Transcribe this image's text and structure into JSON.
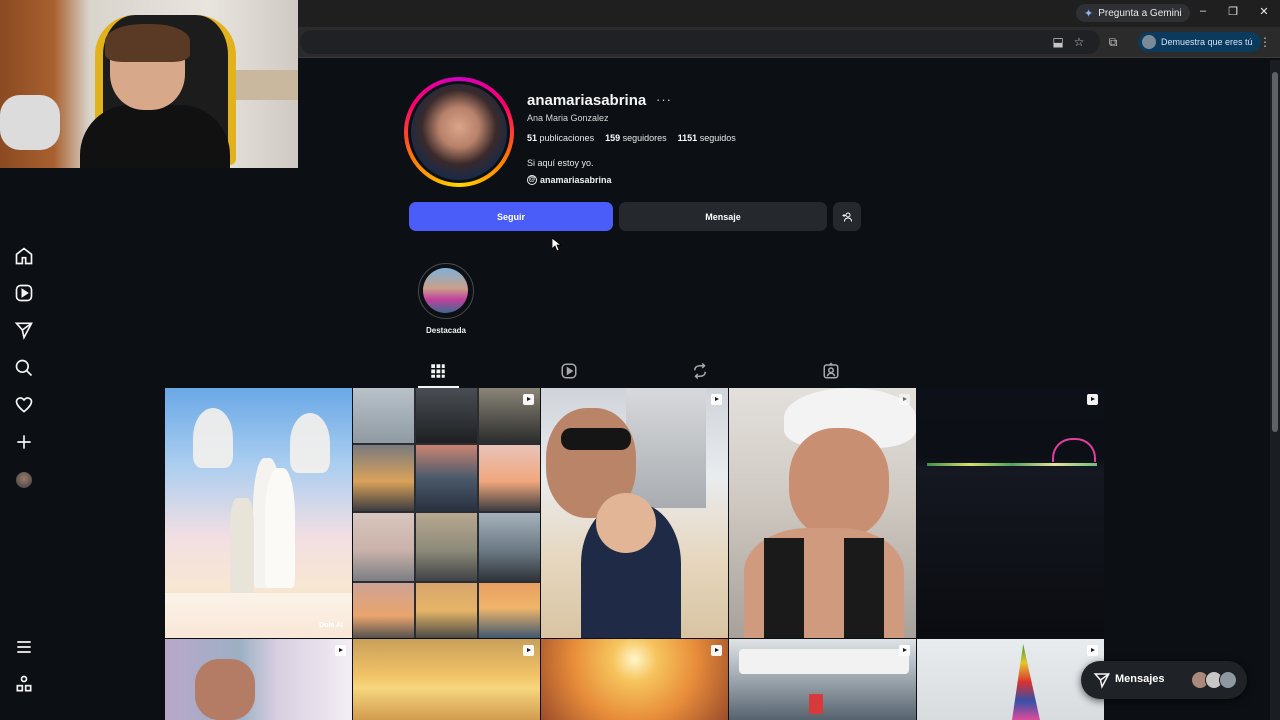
{
  "browser": {
    "gemini_label": "Pregunta a Gemini",
    "profile_chip": "Demuestra que eres tú",
    "window_controls": [
      "–",
      "❐",
      "✕"
    ]
  },
  "profile": {
    "username": "anamariasabrina",
    "more": "···",
    "full_name": "Ana Maria Gonzalez",
    "stats": [
      {
        "count": "51",
        "label": "publicaciones"
      },
      {
        "count": "159",
        "label": "seguidores"
      },
      {
        "count": "1151",
        "label": "seguidos"
      }
    ],
    "bio": "Si aquí estoy yo.",
    "threads_handle": "anamariasabrina",
    "follow_label": "Seguir",
    "message_label": "Mensaje",
    "add_user_glyph": "+👤"
  },
  "highlight": {
    "label": "Destacada"
  },
  "tabs": [
    "posts-grid",
    "reels",
    "reposts",
    "tagged"
  ],
  "grid": {
    "watermark": "Dola AI",
    "tiles": [
      {
        "name": "angels-family-post",
        "reel": false
      },
      {
        "name": "sunset-collage-post",
        "reel": true
      },
      {
        "name": "beach-selfie-post",
        "reel": true
      },
      {
        "name": "white-cap-selfie-post",
        "reel": true
      },
      {
        "name": "night-pier-post",
        "reel": true
      },
      {
        "name": "lavender-beach-post",
        "reel": true
      },
      {
        "name": "golden-sky-post",
        "reel": true
      },
      {
        "name": "sunset-sea-post",
        "reel": true
      },
      {
        "name": "boat-post",
        "reel": true
      },
      {
        "name": "sailboat-post",
        "reel": true
      }
    ]
  },
  "messages": {
    "label": "Mensajes"
  },
  "colors": {
    "background": "#0c1014",
    "primary_button": "#4a5df9",
    "secondary_button": "#25292e"
  }
}
